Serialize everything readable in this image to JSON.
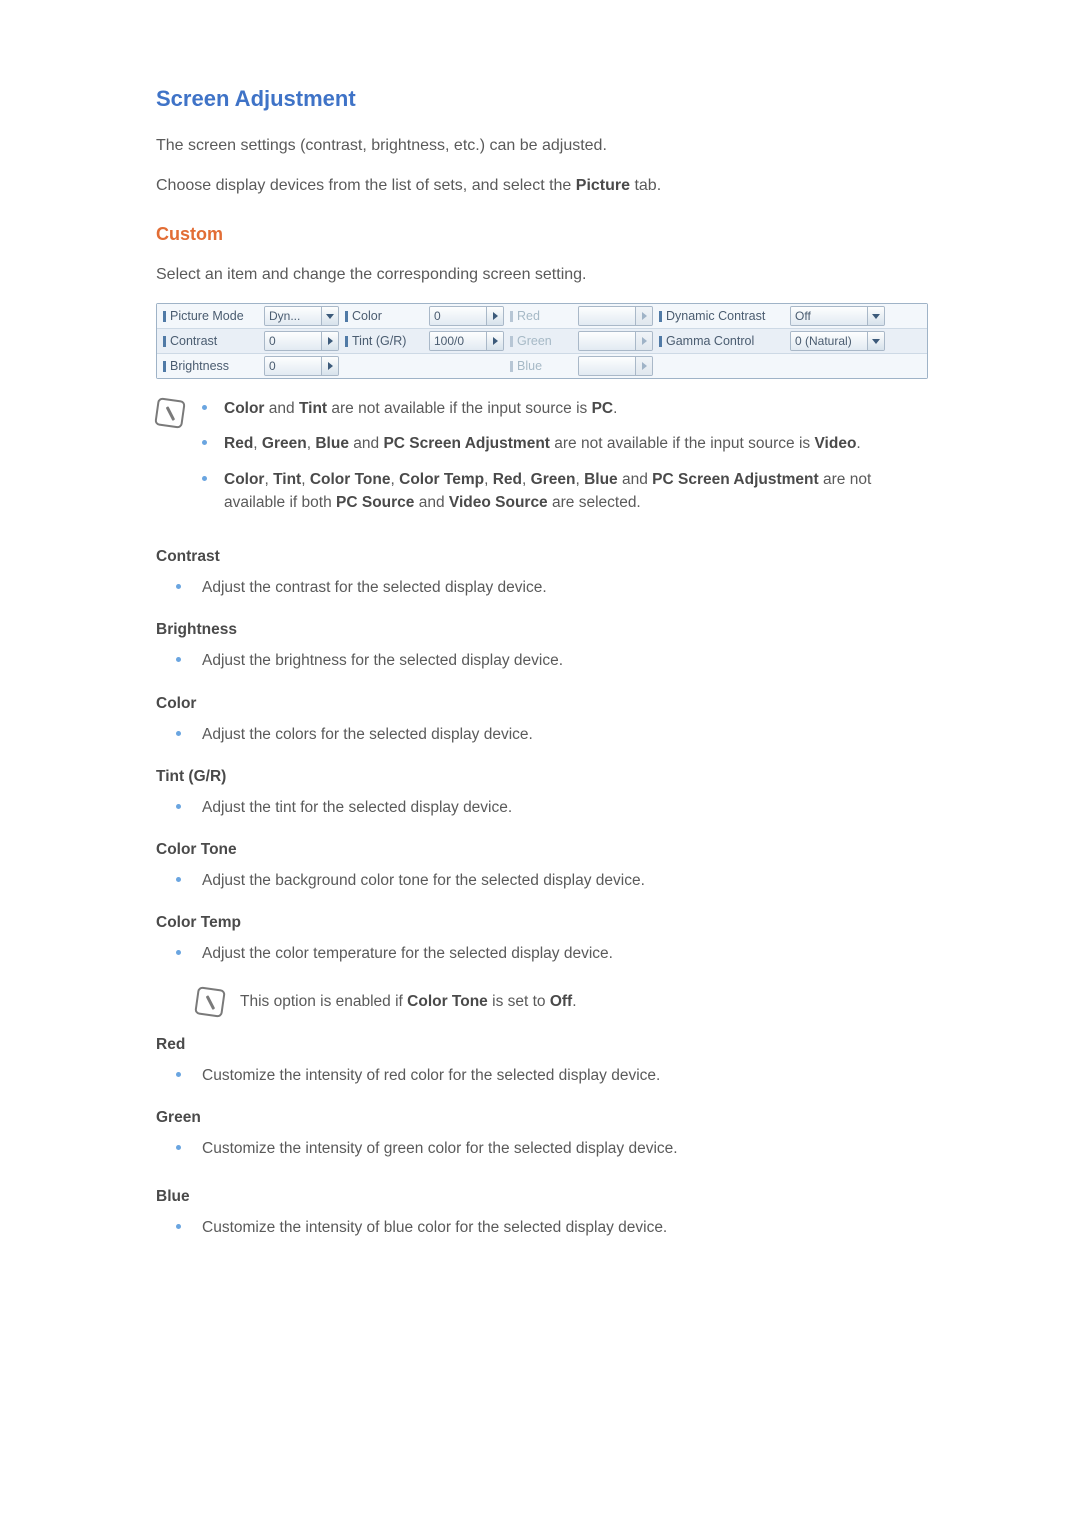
{
  "h1": "Screen Adjustment",
  "intro1_a": "The screen settings (contrast, brightness, etc.) can be adjusted.",
  "intro2_a": "Choose display devices from the list of sets, and select the ",
  "intro2_bold": "Picture",
  "intro2_b": " tab.",
  "h2_custom": "Custom",
  "custom_intro": "Select an item and change the corresponding screen setting.",
  "panel": {
    "picture_mode_lbl": "Picture Mode",
    "picture_mode_val": "Dyn...",
    "color_lbl": "Color",
    "color_val": "0",
    "red_lbl": "Red",
    "red_val": "",
    "dyn_contrast_lbl": "Dynamic Contrast",
    "dyn_contrast_val": "Off",
    "contrast_lbl": "Contrast",
    "contrast_val": "0",
    "tint_lbl": "Tint (G/R)",
    "tint_val": "100/0",
    "green_lbl": "Green",
    "green_val": "",
    "gamma_lbl": "Gamma Control",
    "gamma_val": "0 (Natural)",
    "brightness_lbl": "Brightness",
    "brightness_val": "0",
    "blue_lbl": "Blue",
    "blue_val": ""
  },
  "notes": {
    "n1": {
      "a": "Color",
      "b": " and ",
      "c": "Tint",
      "d": " are not available if the input source is ",
      "e": "PC",
      "f": "."
    },
    "n2": {
      "a": "Red",
      "b": ", ",
      "c": "Green",
      "d": ", ",
      "e": "Blue",
      "f": " and ",
      "g": "PC Screen Adjustment",
      "h": " are not available if the input source is ",
      "i": "Video",
      "j": "."
    },
    "n3": {
      "a": "Color",
      "b": ", ",
      "c": "Tint",
      "d": ", ",
      "e": "Color Tone",
      "f": ", ",
      "g": "Color Temp",
      "h": ", ",
      "i": "Red",
      "j": ", ",
      "k": "Green",
      "l": ", ",
      "m": "Blue",
      "n": " and ",
      "o": "PC Screen Adjustment",
      "p": " are not available if both ",
      "q": "PC Source",
      "r": " and ",
      "s": "Video Source",
      "t": " are selected."
    }
  },
  "fields": {
    "contrast_h": "Contrast",
    "contrast_d": "Adjust the contrast for the selected display device.",
    "brightness_h": "Brightness",
    "brightness_d": "Adjust the brightness for the selected display device.",
    "color_h": "Color",
    "color_d": "Adjust the colors for the selected display device.",
    "tint_h": "Tint (G/R)",
    "tint_d": "Adjust the tint for the selected display device.",
    "colortone_h": "Color Tone",
    "colortone_d": "Adjust the background color tone for the selected display device.",
    "colortemp_h": "Color Temp",
    "colortemp_d": "Adjust the color temperature for the selected display device.",
    "colortemp_note_a": "This option is enabled if ",
    "colortemp_note_b": "Color Tone",
    "colortemp_note_c": " is set to ",
    "colortemp_note_d": "Off",
    "colortemp_note_e": ".",
    "red_h": "Red",
    "red_d": "Customize the intensity of red color for the selected display device.",
    "green_h": "Green",
    "green_d": "Customize the intensity of green color for the selected display device.",
    "blue_h": "Blue",
    "blue_d": "Customize the intensity of blue color for the selected display device."
  }
}
